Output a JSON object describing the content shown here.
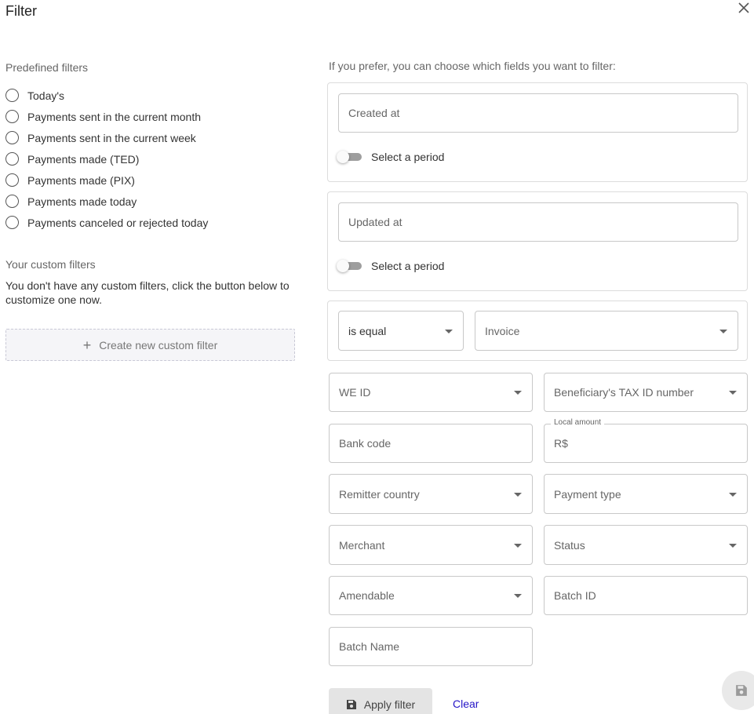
{
  "dialog": {
    "title": "Filter",
    "close_icon": "close-icon"
  },
  "predefined": {
    "heading": "Predefined filters",
    "options": [
      "Today's",
      "Payments sent in the current month",
      "Payments sent in the current week",
      "Payments made (TED)",
      "Payments made (PIX)",
      "Payments made today",
      "Payments canceled or rejected today"
    ]
  },
  "custom": {
    "heading": "Your custom filters",
    "empty_text": "You don't have any custom filters, click the button below to customize one now.",
    "create_label": "Create new custom filter",
    "create_icon": "plus-icon"
  },
  "fields": {
    "intro": "If you prefer, you can choose which fields you want to filter:",
    "created_at": {
      "placeholder": "Created at",
      "toggle_label": "Select a period"
    },
    "updated_at": {
      "placeholder": "Updated at",
      "toggle_label": "Select a period"
    },
    "condition": {
      "operator": "is equal",
      "field": "Invoice"
    },
    "we_id": "WE ID",
    "beneficiary_tax_id": "Beneficiary's TAX ID number",
    "bank_code": "Bank code",
    "local_amount": {
      "label": "Local amount",
      "prefix": "R$"
    },
    "remitter_country": "Remitter country",
    "payment_type": "Payment type",
    "merchant": "Merchant",
    "status": "Status",
    "amendable": "Amendable",
    "batch_id": "Batch ID",
    "batch_name": "Batch Name"
  },
  "actions": {
    "apply_label": "Apply filter",
    "apply_icon": "save-icon",
    "clear_label": "Clear",
    "fab_icon": "save-icon"
  },
  "colors": {
    "link": "#2515c7",
    "button_bg": "#e4e4e4",
    "border": "#c8c8c8"
  }
}
